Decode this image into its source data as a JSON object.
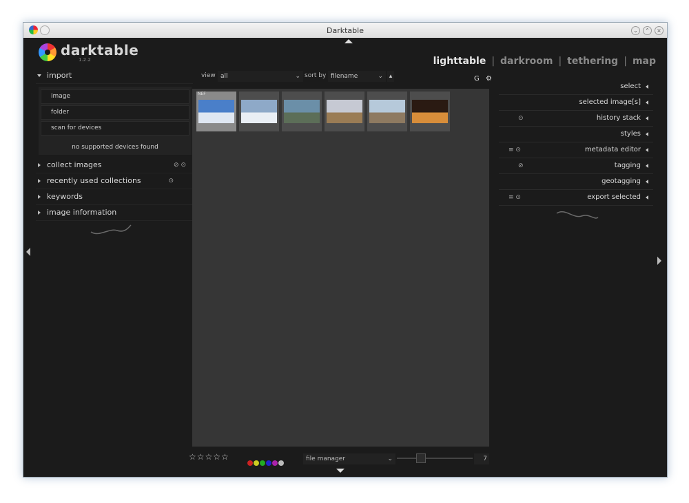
{
  "window": {
    "title": "Darktable"
  },
  "logo": {
    "name": "darktable",
    "version": "1.2.2"
  },
  "views": [
    {
      "label": "lighttable",
      "active": true
    },
    {
      "label": "darkroom",
      "active": false
    },
    {
      "label": "tethering",
      "active": false
    },
    {
      "label": "map",
      "active": false
    }
  ],
  "left_panel": {
    "import": {
      "title": "import",
      "buttons": [
        "image",
        "folder",
        "scan for devices"
      ],
      "message": "no supported devices found"
    },
    "modules": [
      "collect images",
      "recently used collections",
      "keywords",
      "image information"
    ]
  },
  "toolbar": {
    "view_label": "view",
    "view_value": "all",
    "sort_label": "sort by",
    "sort_value": "filename",
    "sort_dir": "▴",
    "group_label": "G"
  },
  "thumbnails": [
    {
      "tag": "NEF",
      "selected": true,
      "colors": [
        "#4a7fc9",
        "#dfe7f2"
      ]
    },
    {
      "tag": "",
      "selected": false,
      "colors": [
        "#8ea9c8",
        "#e9eef4"
      ]
    },
    {
      "tag": "",
      "selected": false,
      "colors": [
        "#6b8fa8",
        "#5c6e58"
      ]
    },
    {
      "tag": "",
      "selected": false,
      "colors": [
        "#c6c9d3",
        "#9a7c55"
      ]
    },
    {
      "tag": "",
      "selected": false,
      "colors": [
        "#b6c9da",
        "#8e7a61"
      ]
    },
    {
      "tag": "",
      "selected": false,
      "colors": [
        "#2a1a12",
        "#d78d3a"
      ]
    }
  ],
  "right_panel": {
    "modules": [
      {
        "label": "select",
        "icons": ""
      },
      {
        "label": "selected image[s]",
        "icons": ""
      },
      {
        "label": "history stack",
        "icons": "⊙"
      },
      {
        "label": "styles",
        "icons": ""
      },
      {
        "label": "metadata editor",
        "icons": "≡ ⊙"
      },
      {
        "label": "tagging",
        "icons": "⊘"
      },
      {
        "label": "geotagging",
        "icons": ""
      },
      {
        "label": "export selected",
        "icons": "≡ ⊙"
      }
    ]
  },
  "bottom": {
    "stars": "☆☆☆☆☆",
    "color_labels": [
      "#cc2222",
      "#cccc22",
      "#22aa22",
      "#2222cc",
      "#aa22aa",
      "#bbbbbb"
    ],
    "layout": "file manager",
    "zoom_value": "7"
  },
  "icons": {
    "settings": "gear-icon",
    "left_toggle": "left-panel-toggle-icon",
    "right_toggle": "right-panel-toggle-icon",
    "top_toggle": "top-panel-toggle-icon",
    "bottom_toggle": "bottom-panel-toggle-icon"
  }
}
